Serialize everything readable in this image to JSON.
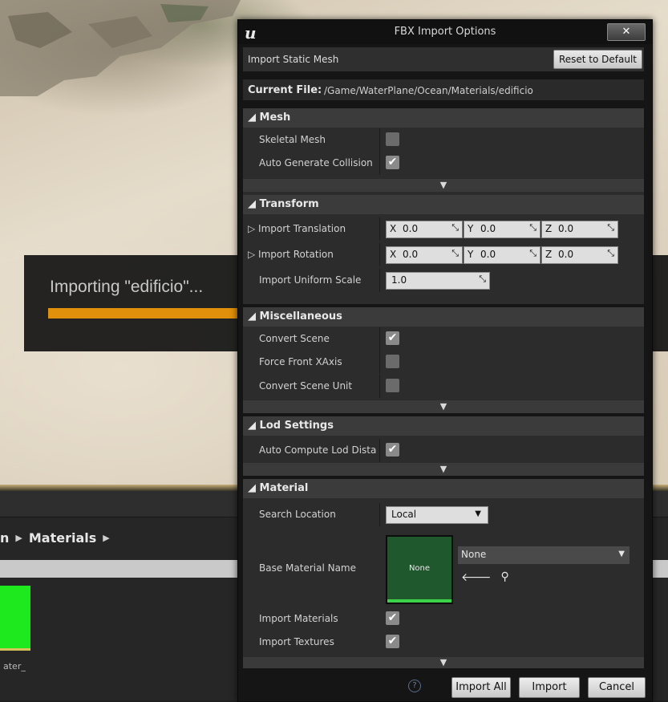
{
  "viewport": {
    "importing_text": "Importing \"edificio\"...",
    "import_progress": 0.4
  },
  "content_browser": {
    "breadcrumb_prev_tail": "n",
    "breadcrumb_current": "Materials",
    "thumb_label": "ater_"
  },
  "dialog": {
    "title": "FBX Import Options",
    "close_label": "✕",
    "mode_label": "Import Static Mesh",
    "reset_label": "Reset to Default",
    "current_file_label": "Current File:",
    "current_file_path": "/Game/WaterPlane/Ocean/Materials/edificio",
    "sections": {
      "mesh": {
        "title": "Mesh",
        "skeletal_mesh": "Skeletal Mesh",
        "auto_generate_collision": "Auto Generate Collision"
      },
      "transform": {
        "title": "Transform",
        "import_translation": "Import Translation",
        "import_rotation": "Import Rotation",
        "import_uniform_scale": "Import Uniform Scale",
        "axis_x": "X",
        "axis_y": "Y",
        "axis_z": "Z",
        "translation": {
          "x": "0.0",
          "y": "0.0",
          "z": "0.0"
        },
        "rotation": {
          "x": "0.0",
          "y": "0.0",
          "z": "0.0"
        },
        "uniform_scale": "1.0"
      },
      "misc": {
        "title": "Miscellaneous",
        "convert_scene": "Convert Scene",
        "force_front_xaxis": "Force Front XAxis",
        "convert_scene_unit": "Convert Scene Unit"
      },
      "lod": {
        "title": "Lod Settings",
        "auto_compute_lod_distances": "Auto Compute Lod Dista"
      },
      "material": {
        "title": "Material",
        "search_location": "Search Location",
        "search_location_value": "Local",
        "base_material_name": "Base Material Name",
        "base_material_thumb": "None",
        "base_material_value": "None",
        "import_materials": "Import Materials",
        "import_textures": "Import Textures"
      }
    },
    "footer": {
      "help_glyph": "?",
      "import_all": "Import All",
      "import": "Import",
      "cancel": "Cancel"
    }
  },
  "colors": {
    "progress": "#e0900a",
    "material_thumb": "#20582e",
    "content_thumb": "#1ee81e"
  }
}
